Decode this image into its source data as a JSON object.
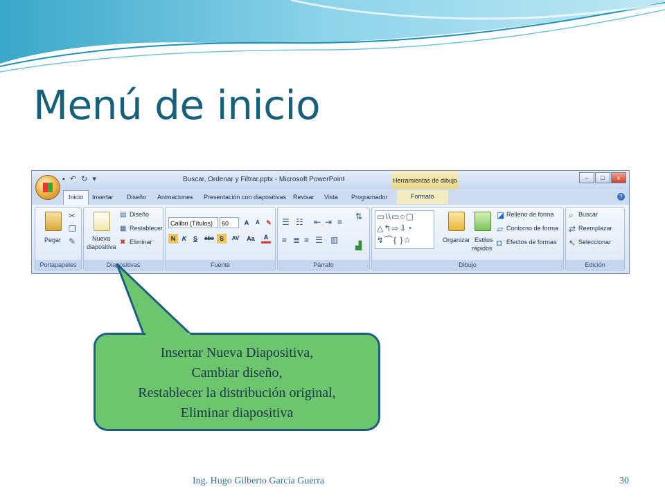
{
  "slide": {
    "title": "Menú de inicio",
    "footer": "Ing. Hugo Gilberto García Guerra",
    "page_number": "30"
  },
  "window": {
    "title": "Buscar, Ordenar y Filtrar.pptx - Microsoft PowerPoint",
    "contextual_tab_header": "Herramientas de dibujo",
    "controls": [
      "–",
      "□",
      "x"
    ]
  },
  "tabs": [
    "Inicio",
    "Insertar",
    "Diseño",
    "Animaciones",
    "Presentación con diapositivas",
    "Revisar",
    "Vista",
    "Programador",
    "Formato"
  ],
  "ribbon": {
    "portapapeles": {
      "label": "Portapapeles",
      "paste": "Pegar"
    },
    "diapositivas": {
      "label": "Diapositivas",
      "nueva_line1": "Nueva",
      "nueva_line2": "diapositiva",
      "diseno": "Diseño",
      "restablecer": "Restablecer",
      "eliminar": "Eliminar"
    },
    "fuente": {
      "label": "Fuente",
      "font_name": "Calibri (Títulos)",
      "font_size": "60",
      "format_buttons": [
        "N",
        "K",
        "S",
        "abc",
        "S",
        "AV",
        "Aa",
        "A"
      ]
    },
    "parrafo": {
      "label": "Párrafo"
    },
    "dibujo": {
      "label": "Dibujo",
      "organizar": "Organizar",
      "estilos_line1": "Estilos",
      "estilos_line2": "rápidos",
      "relleno": "Relleno de forma",
      "contorno": "Contorno de forma",
      "efectos": "Efectos de formas"
    },
    "edicion": {
      "label": "Edición",
      "buscar": "Buscar",
      "reemplazar": "Reemplazar",
      "seleccionar": "Seleccionar"
    }
  },
  "callout": {
    "lines": [
      "Insertar Nueva Diapositiva,",
      "Cambiar diseño,",
      "Restablecer  la distribución original,",
      "Eliminar diapositiva"
    ]
  }
}
